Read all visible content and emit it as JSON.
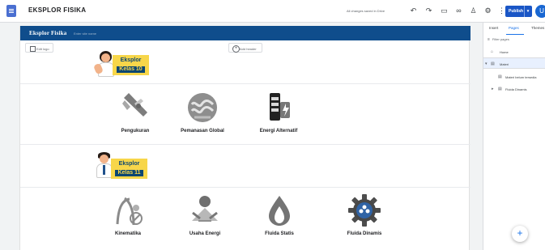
{
  "app": {
    "site_title": "EKSPLOR FISIKA",
    "saved_status": "All changes saved in Drive",
    "publish_label": "Publish",
    "avatar_letter": "U"
  },
  "toolbar": {
    "undo_icon": "undo-icon",
    "redo_icon": "redo-icon",
    "preview_icon": "preview-icon",
    "link_icon": "link-icon",
    "share_icon": "share-icon",
    "settings_icon": "settings-icon",
    "more_icon": "more-icon"
  },
  "editor": {
    "header_logo": "Eksplor Fisika",
    "site_name_placeholder": "Enter site name",
    "edit_logo_label": "Edit logo",
    "add_header_label": "Add header",
    "class_10": {
      "line1": "Eksplor",
      "line2": "Kelas 10"
    },
    "class_11": {
      "line1": "Eksplor",
      "line2": "Kelas 11"
    },
    "topics_10": [
      {
        "label": "Pengukuran",
        "icon": "caliper-icon"
      },
      {
        "label": "Pemanasan Global",
        "icon": "global-warming-icon"
      },
      {
        "label": "Energi Alternatif",
        "icon": "battery-energy-icon"
      }
    ],
    "topics_11": [
      {
        "label": "Kinematika",
        "icon": "kinematics-icon"
      },
      {
        "label": "Usaha Energi",
        "icon": "work-energy-icon"
      },
      {
        "label": "Fluida Statis",
        "icon": "fluid-drop-icon"
      },
      {
        "label": "Fluida Dinamis",
        "icon": "fluid-gear-icon"
      }
    ]
  },
  "right_panel": {
    "tabs": [
      {
        "label": "Insert"
      },
      {
        "label": "Pages"
      },
      {
        "label": "Themes"
      }
    ],
    "filter_placeholder": "Filter pages",
    "pages": [
      {
        "label": "Home"
      },
      {
        "label": "Materi"
      },
      {
        "label": "Materi belum tersedia"
      },
      {
        "label": "Fluida Dinamis"
      }
    ]
  },
  "colors": {
    "header_blue": "#0f4d8c",
    "accent_blue": "#1a73e8",
    "badge_yellow": "#f7d64a",
    "badge_navy": "#0b4672"
  }
}
